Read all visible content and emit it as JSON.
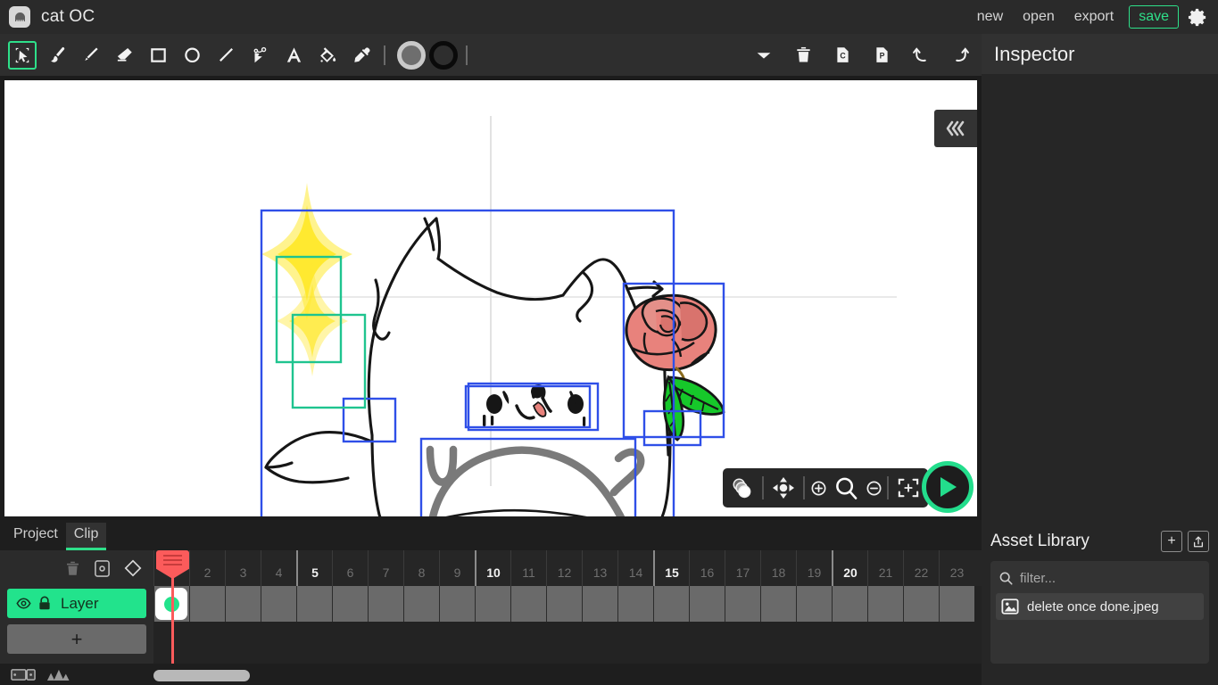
{
  "app": {
    "logo_icon": "app-logo-icon",
    "title": "cat OC"
  },
  "titlebar": {
    "menus": [
      {
        "label": "new",
        "name": "new-button"
      },
      {
        "label": "open",
        "name": "open-button"
      },
      {
        "label": "export",
        "name": "export-button"
      }
    ],
    "save_label": "save",
    "save_color": "#2ee08a",
    "settings_icon": "gear-icon"
  },
  "toolbar": {
    "tools": [
      {
        "name": "select-tool",
        "icon": "cursor-select-icon",
        "active": true
      },
      {
        "name": "brush-tool",
        "icon": "paintbrush-icon",
        "active": false
      },
      {
        "name": "pencil-tool",
        "icon": "pencil-icon",
        "active": false
      },
      {
        "name": "eraser-tool",
        "icon": "eraser-icon",
        "active": false
      },
      {
        "name": "rectangle-tool",
        "icon": "square-icon",
        "active": false
      },
      {
        "name": "ellipse-tool",
        "icon": "circle-icon",
        "active": false
      },
      {
        "name": "line-tool",
        "icon": "line-icon",
        "active": false
      },
      {
        "name": "path-tool",
        "icon": "bezier-pen-icon",
        "active": false
      },
      {
        "name": "text-tool",
        "icon": "text-a-icon",
        "active": false
      },
      {
        "name": "fill-tool",
        "icon": "paint-bucket-icon",
        "active": false
      },
      {
        "name": "eyedropper-tool",
        "icon": "eyedropper-icon",
        "active": false
      }
    ],
    "fill_swatch_color": "#6e6e6e",
    "fill_swatch_ring": "#c9c9c9",
    "stroke_swatch_color": "#0a0a0a",
    "right_actions": [
      {
        "name": "dropdown-button",
        "icon": "chevron-down-icon"
      },
      {
        "name": "delete-button",
        "icon": "trash-icon"
      },
      {
        "name": "copy-button",
        "icon": "copy-c-icon"
      },
      {
        "name": "paste-button",
        "icon": "paste-p-icon"
      },
      {
        "name": "undo-button",
        "icon": "undo-icon"
      },
      {
        "name": "redo-button",
        "icon": "redo-icon"
      }
    ]
  },
  "canvas": {
    "background": "#ffffff",
    "collapse_icon": "chevron-triple-left-icon",
    "tools": [
      {
        "name": "onion-skin-button",
        "icon": "onion-skin-icon"
      },
      {
        "name": "pan-tool-button",
        "icon": "move-pan-icon"
      },
      {
        "name": "zoom-in-button",
        "icon": "zoom-in-icon"
      },
      {
        "name": "zoom-tool-button",
        "icon": "magnifier-icon"
      },
      {
        "name": "zoom-out-button",
        "icon": "zoom-out-icon"
      },
      {
        "name": "fit-to-screen-button",
        "icon": "fit-screen-icon"
      }
    ],
    "play_button": {
      "name": "play-button",
      "icon": "play-icon",
      "color": "#23dd8c"
    },
    "artwork": {
      "description": "hand-drawn cat OC line sketch with rose, sparkles and selection bounding boxes",
      "selection_box_color": "#2f4fe8",
      "sparkle_box_color": "#1fc48f",
      "sparkle_color": "#ffe81f",
      "rose_petal_color": "#e8827c",
      "rose_petal_shadow": "#c96a66",
      "leaf_color": "#16c82a",
      "tongue_color": "#e8827c",
      "belly_stroke_color": "#7a7a7a",
      "ink_color": "#161616"
    }
  },
  "inspector": {
    "title": "Inspector",
    "content": ""
  },
  "asset_library": {
    "title": "Asset Library",
    "add_label": "+",
    "add_icon": "plus-icon",
    "upload_icon": "upload-share-icon",
    "filter_icon": "search-icon",
    "filter_placeholder": "filter...",
    "filter_value": "",
    "items": [
      {
        "label": "delete once done.jpeg",
        "icon": "image-file-icon"
      }
    ]
  },
  "timeline": {
    "tabs": [
      {
        "label": "Project",
        "active": false,
        "name": "tab-project"
      },
      {
        "label": "Clip",
        "active": true,
        "name": "tab-clip"
      }
    ],
    "layer_actions": [
      {
        "name": "delete-layer-button",
        "icon": "trash-icon"
      },
      {
        "name": "onion-skin-layer-button",
        "icon": "onion-frame-icon"
      },
      {
        "name": "add-keyframe-button",
        "icon": "diamond-keyframe-icon"
      }
    ],
    "layer": {
      "name": "Layer",
      "visible_icon": "eye-icon",
      "lock_icon": "lock-icon",
      "color": "#22e38c"
    },
    "add_layer_label": "+",
    "playhead_frame": 1,
    "frames": [
      {
        "n": "",
        "major": false
      },
      {
        "n": "2",
        "major": false
      },
      {
        "n": "3",
        "major": false
      },
      {
        "n": "4",
        "major": false
      },
      {
        "n": "5",
        "major": true
      },
      {
        "n": "6",
        "major": false
      },
      {
        "n": "7",
        "major": false
      },
      {
        "n": "8",
        "major": false
      },
      {
        "n": "9",
        "major": false
      },
      {
        "n": "10",
        "major": true
      },
      {
        "n": "11",
        "major": false
      },
      {
        "n": "12",
        "major": false
      },
      {
        "n": "13",
        "major": false
      },
      {
        "n": "14",
        "major": false
      },
      {
        "n": "15",
        "major": true
      },
      {
        "n": "16",
        "major": false
      },
      {
        "n": "17",
        "major": false
      },
      {
        "n": "18",
        "major": false
      },
      {
        "n": "19",
        "major": false
      },
      {
        "n": "20",
        "major": true
      },
      {
        "n": "21",
        "major": false
      },
      {
        "n": "22",
        "major": false
      },
      {
        "n": "23",
        "major": false
      }
    ],
    "footer_icons": [
      {
        "name": "timeline-view-button",
        "icon": "frames-view-icon"
      },
      {
        "name": "graph-view-button",
        "icon": "mountain-graph-icon"
      }
    ]
  }
}
